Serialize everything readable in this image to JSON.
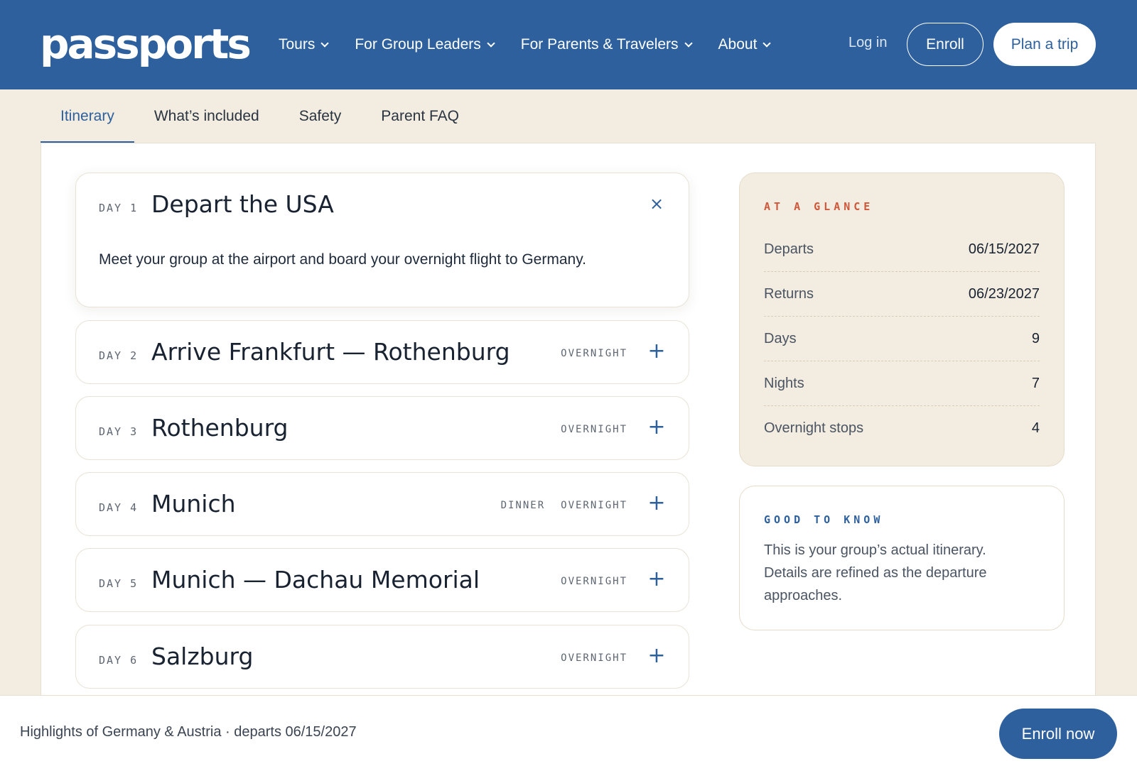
{
  "brand": {
    "logo_text": "passports",
    "primary_color": "#2d609d",
    "accent_color": "#d0583a",
    "background_color": "#f3ece0"
  },
  "nav": {
    "items": [
      {
        "label": "Tours",
        "icon": "chevron-down-icon"
      },
      {
        "label": "For Group Leaders",
        "icon": "chevron-down-icon"
      },
      {
        "label": "For Parents & Travelers",
        "icon": "chevron-down-icon"
      },
      {
        "label": "About",
        "icon": "chevron-down-icon"
      }
    ],
    "login_label": "Log in",
    "enroll_label": "Enroll",
    "plan_label": "Plan a trip"
  },
  "tabs": [
    {
      "label": "Itinerary",
      "active": true
    },
    {
      "label": "What’s included",
      "active": false
    },
    {
      "label": "Safety",
      "active": false
    },
    {
      "label": "Parent FAQ",
      "active": false
    }
  ],
  "itinerary": {
    "days": [
      {
        "day_label": "DAY 1",
        "title": "Depart the USA",
        "expanded": true,
        "tags": [],
        "toggle": "×",
        "toggle_icon": "close-icon",
        "description": "Meet your group at the airport and board your overnight flight to Germany."
      },
      {
        "day_label": "DAY 2",
        "title": "Arrive Frankfurt — Rothenburg",
        "expanded": false,
        "tags": [
          "OVERNIGHT"
        ],
        "toggle": "+",
        "toggle_icon": "plus-icon"
      },
      {
        "day_label": "DAY 3",
        "title": "Rothenburg",
        "expanded": false,
        "tags": [
          "OVERNIGHT"
        ],
        "toggle": "+",
        "toggle_icon": "plus-icon"
      },
      {
        "day_label": "DAY 4",
        "title": "Munich",
        "expanded": false,
        "tags": [
          "DINNER",
          "OVERNIGHT"
        ],
        "toggle": "+",
        "toggle_icon": "plus-icon"
      },
      {
        "day_label": "DAY 5",
        "title": "Munich — Dachau Memorial",
        "expanded": false,
        "tags": [
          "OVERNIGHT"
        ],
        "toggle": "+",
        "toggle_icon": "plus-icon"
      },
      {
        "day_label": "DAY 6",
        "title": "Salzburg",
        "expanded": false,
        "tags": [
          "OVERNIGHT"
        ],
        "toggle": "+",
        "toggle_icon": "plus-icon"
      }
    ]
  },
  "at_a_glance": {
    "heading": "AT A GLANCE",
    "rows": [
      {
        "label": "Departs",
        "value": "06/15/2027"
      },
      {
        "label": "Returns",
        "value": "06/23/2027"
      },
      {
        "label": "Days",
        "value": "9"
      },
      {
        "label": "Nights",
        "value": "7"
      },
      {
        "label": "Overnight stops",
        "value": "4"
      }
    ]
  },
  "good_to_know": {
    "heading": "GOOD TO KNOW",
    "body": "This is your group’s actual itinerary. Details are refined as the departure approaches."
  },
  "footer_bar": {
    "summary": "Highlights of Germany & Austria · departs 06/15/2027",
    "cta_label": "Enroll now"
  }
}
